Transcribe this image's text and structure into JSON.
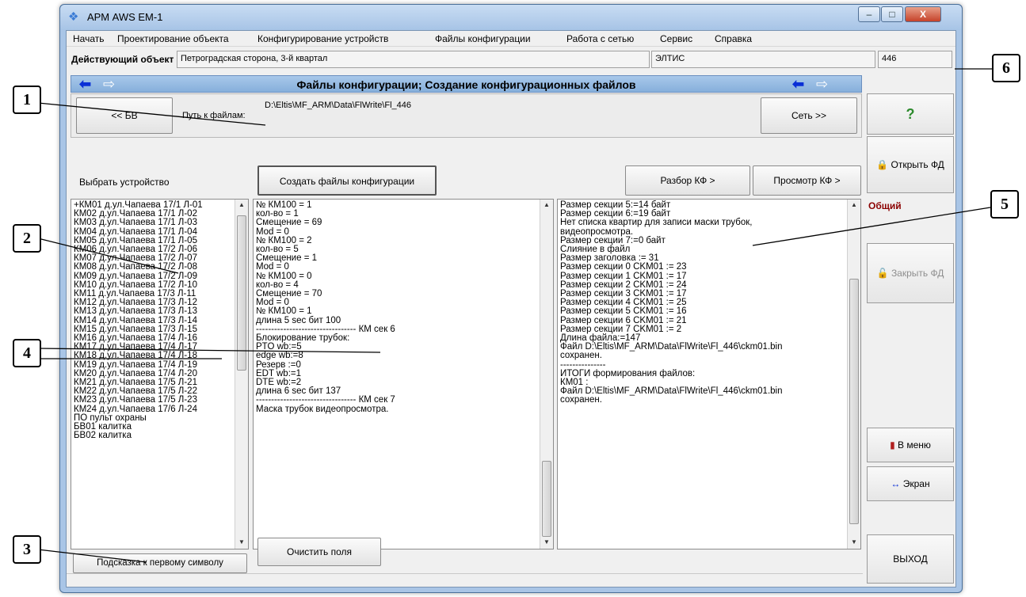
{
  "window": {
    "title": "АРМ AWS EM-1",
    "controls": {
      "minimize": "–",
      "maximize": "□",
      "close": "X"
    }
  },
  "menu": [
    "Начать",
    "Проектирование объекта",
    "Конфигурирование устройств",
    "Файлы конфигурации",
    "Работа с сетью",
    "Сервис",
    "Справка"
  ],
  "object_row": {
    "label": "Действующий объект",
    "name": "Петроградская сторона, 3-й квартал",
    "org": "ЭЛТИС",
    "number": "446"
  },
  "header": {
    "title": "Файлы конфигурации; Создание конфигурационных файлов"
  },
  "path": {
    "back_button": "<< БВ",
    "label": "Путь к файлам:",
    "value": "D:\\Eltis\\MF_ARM\\Data\\FlWrite\\Fl_446",
    "net_button": "Сеть >>"
  },
  "toolbar": {
    "select_label": "Выбрать устройство",
    "create_button": "Создать файлы конфигурации",
    "parse_button": "Разбор КФ >",
    "view_button": "Просмотр КФ >"
  },
  "device_list": [
    "+КМ01 д.ул.Чапаева 17/1 Л-01",
    "КМ02 д.ул.Чапаева 17/1 Л-02",
    "КМ03 д.ул.Чапаева 17/1 Л-03",
    "КМ04 д.ул.Чапаева 17/1 Л-04",
    "КМ05 д.ул.Чапаева 17/1 Л-05",
    "КМ06 д.ул.Чапаева 17/2 Л-06",
    "КМ07 д.ул.Чапаева 17/2 Л-07",
    "КМ08 д.ул.Чапаева 17/2 Л-08",
    "КМ09 д.ул.Чапаева 17/2 Л-09",
    "КМ10 д.ул.Чапаева 17/2 Л-10",
    "КМ11 д.ул.Чапаева 17/3 Л-11",
    "КМ12 д.ул.Чапаева 17/3 Л-12",
    "КМ13 д.ул.Чапаева 17/3 Л-13",
    "КМ14 д.ул.Чапаева 17/3 Л-14",
    "КМ15 д.ул.Чапаева 17/3 Л-15",
    "КМ16 д.ул.Чапаева 17/4 Л-16",
    "КМ17 д.ул.Чапаева 17/4 Л-17",
    "КМ18 д.ул.Чапаева 17/4 Л-18",
    "КМ19 д.ул.Чапаева 17/4 Л-19",
    "КМ20 д.ул.Чапаева 17/4 Л-20",
    "КМ21 д.ул.Чапаева 17/5 Л-21",
    "КМ22 д.ул.Чапаева 17/5 Л-22",
    "КМ23 д.ул.Чапаева 17/5 Л-23",
    "КМ24 д.ул.Чапаева 17/6 Л-24",
    "ПО  пульт охраны",
    "БВ01 калитка",
    "БВ02 калитка"
  ],
  "hint_button": "Подсказка к первому символу",
  "clear_button": "Очистить поля",
  "log_left": [
    "№ КМ100 = 1",
    "кол-во = 1",
    "Смещение = 69",
    "Mod = 0",
    "№ КМ100 = 2",
    "кол-во = 5",
    "Смещение = 1",
    "Mod = 0",
    "№ КМ100 = 0",
    "кол-во = 4",
    "Смещение = 70",
    "Mod = 0",
    "№ КМ100 = 1",
    "длина 5 sec бит 100",
    "--------------------------------- КМ сек 6",
    "Блокирование трубок:",
    "PTO wb:=5",
    "edge wb:=8",
    "Резерв :=0",
    "EDT wb:=1",
    "DTE wb:=2",
    "длина 6 sec бит 137",
    "--------------------------------- КМ сек 7",
    "Маска трубок видеопросмотра."
  ],
  "log_right": [
    "Размер секции 5:=14 байт",
    "Размер секции 6:=19 байт",
    "Нет списка квартир для записи маски трубок,",
    "видеопросмотра.",
    "Размер секции 7:=0 байт",
    "Слияние в файл",
    "Размер заголовка := 31",
    "Размер секции 0 CKM01 := 23",
    "Размер секции 1 CKM01 := 17",
    "Размер секции 2 CKM01 := 24",
    "Размер секции 3 CKM01 := 17",
    "Размер секции 4 CKM01 := 25",
    "Размер секции 5 CKM01 := 16",
    "Размер секции 6 CKM01 := 21",
    "Размер секции 7 CKM01 := 2",
    "Длина файла:=147",
    "Файл D:\\Eltis\\MF_ARM\\Data\\FlWrite\\Fl_446\\ckm01.bin",
    "сохранен.",
    "---------------",
    "ИТОГИ формирования файлов:",
    "КМ01 :",
    "Файл D:\\Eltis\\MF_ARM\\Data\\FlWrite\\Fl_446\\ckm01.bin",
    "сохранен."
  ],
  "right_panel": {
    "help": "?",
    "open_fd": "Открыть ФД",
    "common_label": "Общий",
    "close_fd": "Закрыть ФД",
    "menu_button": "В меню",
    "screen_button": "Экран",
    "exit_button": "ВЫХОД"
  },
  "callouts": [
    "1",
    "2",
    "3",
    "4",
    "5",
    "6"
  ],
  "colors": {
    "header_bg": "#86afdb",
    "arrow_blue": "#0a2fd6",
    "common_label": "#8b0000",
    "help_green": "#2e8b2e"
  }
}
